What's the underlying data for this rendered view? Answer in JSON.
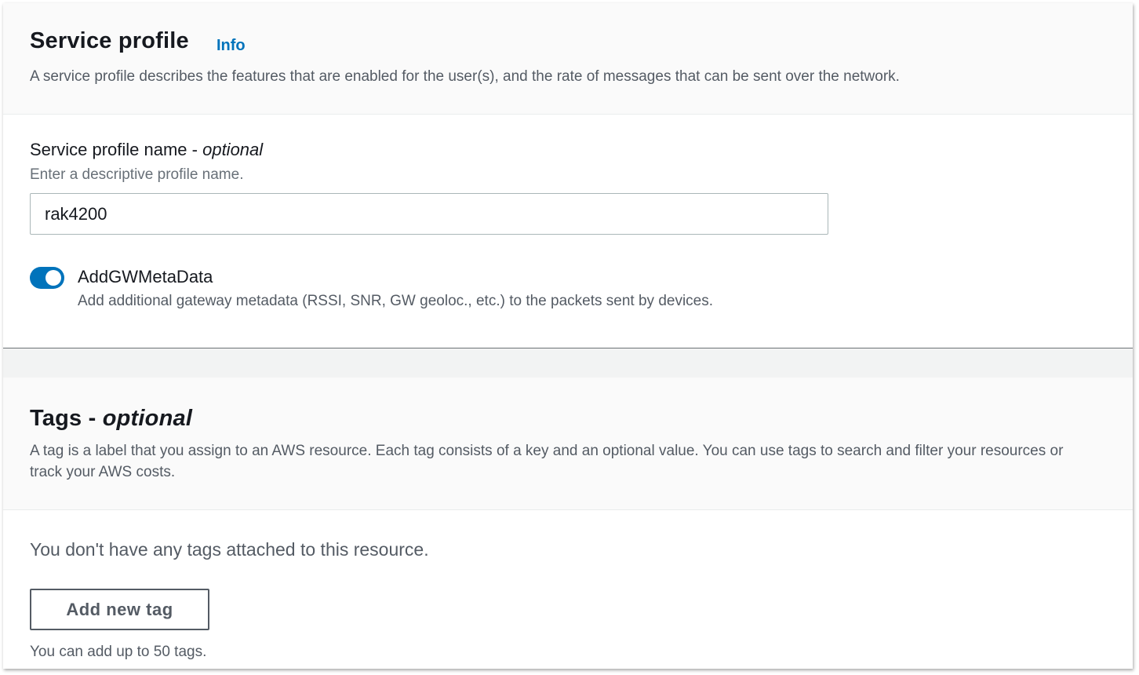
{
  "service_profile": {
    "title": "Service profile",
    "info_link": "Info",
    "description": "A service profile describes the features that are enabled for the user(s), and the rate of messages that can be sent over the network.",
    "name_field": {
      "label": "Service profile name - ",
      "label_optional": "optional",
      "hint": "Enter a descriptive profile name.",
      "value": "rak4200"
    },
    "toggle": {
      "label": "AddGWMetaData",
      "description": "Add additional gateway metadata (RSSI, SNR, GW geoloc., etc.) to the packets sent by devices.",
      "checked": true
    }
  },
  "tags": {
    "title": "Tags - ",
    "title_optional": "optional",
    "description": "A tag is a label that you assign to an AWS resource. Each tag consists of a key and an optional value. You can use tags to search and filter your resources or track your AWS costs.",
    "empty_message": "You don't have any tags attached to this resource.",
    "add_button": "Add new tag",
    "limit_text": "You can add up to 50 tags."
  },
  "colors": {
    "accent": "#0073bb",
    "text": "#16191f",
    "secondary_text": "#545b64"
  }
}
